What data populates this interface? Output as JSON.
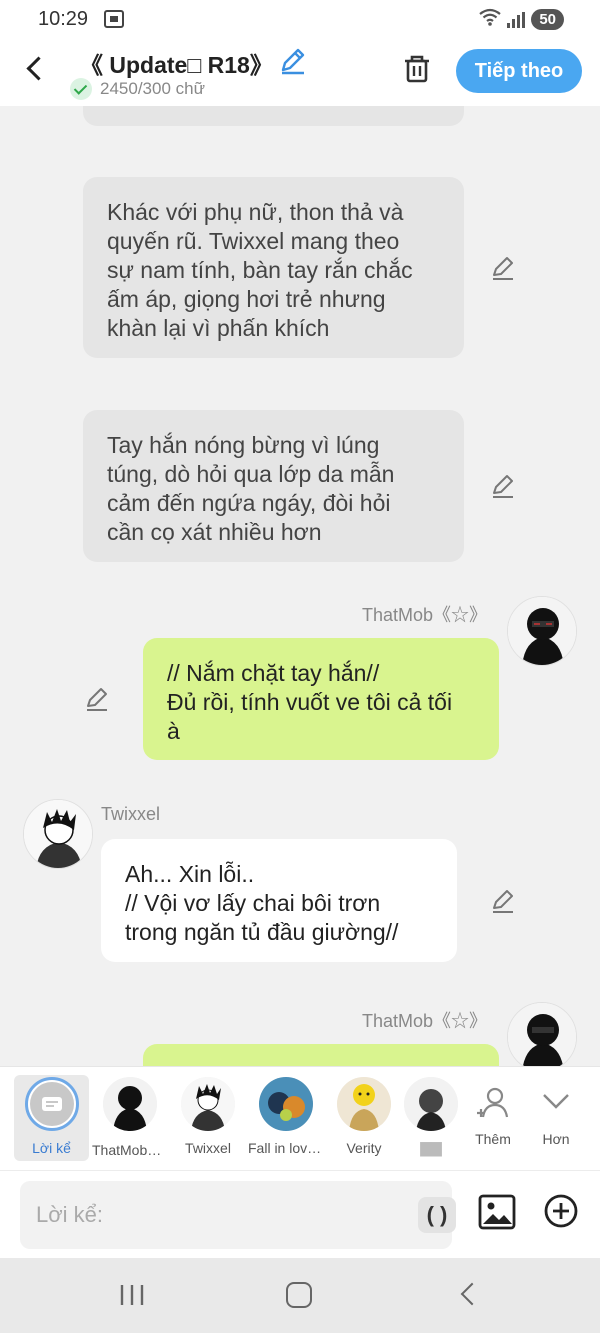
{
  "status": {
    "time": "10:29",
    "battery": "50"
  },
  "header": {
    "title": "《 Update□ R18》",
    "word_count": "2450/300 chữ",
    "next_label": "Tiếp theo"
  },
  "messages": {
    "m1": {
      "lines": [
        "Khác với phụ nữ, thon thả và",
        "quyến rũ. Twixxel mang theo",
        "sự nam tính, bàn tay rắn chắc",
        "ấm áp, giọng hơi trẻ nhưng",
        "khàn lại vì phấn khích"
      ]
    },
    "m2": {
      "lines": [
        "Tay hắn nóng bừng vì lúng",
        "túng, dò hỏi qua lớp da mẫn",
        "cảm đến ngứa ngáy, đòi hỏi",
        "cần cọ xát nhiều hơn"
      ]
    },
    "m3": {
      "speaker": "ThatMob《☆》",
      "lines": [
        "// Nắm chặt tay hắn//",
        "Đủ rồi, tính vuốt ve tôi cả tối",
        "à"
      ]
    },
    "m4": {
      "speaker": "Twixxel",
      "lines": [
        "Ah... Xin lỗi..",
        "// Vội vơ lấy chai bôi trơn",
        "trong ngăn tủ đầu giường//"
      ]
    },
    "m5": {
      "speaker": "ThatMob《☆》"
    }
  },
  "characters": {
    "narrator": "Lời kể",
    "c1": "ThatMob《☆》",
    "c2": "Twixxel",
    "c3": "Fall in love with a...",
    "c4": "Verity",
    "c5": "▇▇",
    "more": "Thêm",
    "collapse": "Hơn"
  },
  "input": {
    "placeholder": "Lời kể:",
    "paren": "( )"
  },
  "colors": {
    "accent": "#4aa7f1",
    "user_bubble": "#d9f48f",
    "narration_bubble": "#e5e5e5"
  }
}
